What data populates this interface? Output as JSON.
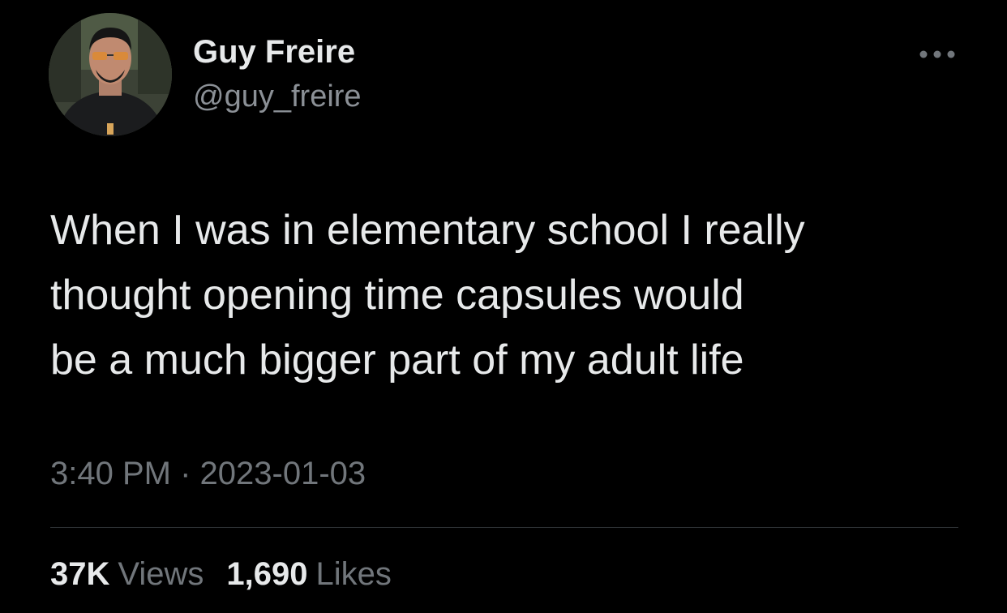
{
  "author": {
    "display_name": "Guy Freire",
    "handle": "@guy_freire"
  },
  "tweet": {
    "text": "When I was in elementary school I really\nthought opening time capsules would\nbe a much bigger part of my adult life"
  },
  "meta": {
    "time": "3:40 PM",
    "separator": "·",
    "date": "2023-01-03"
  },
  "stats": {
    "views_value": "37K",
    "views_label": "Views",
    "likes_value": "1,690",
    "likes_label": "Likes"
  },
  "icons": {
    "more": "more-horizontal-icon"
  },
  "colors": {
    "background": "#000000",
    "primary_text": "#e7e9ea",
    "secondary_text": "#71767b",
    "divider": "#2f3336"
  }
}
